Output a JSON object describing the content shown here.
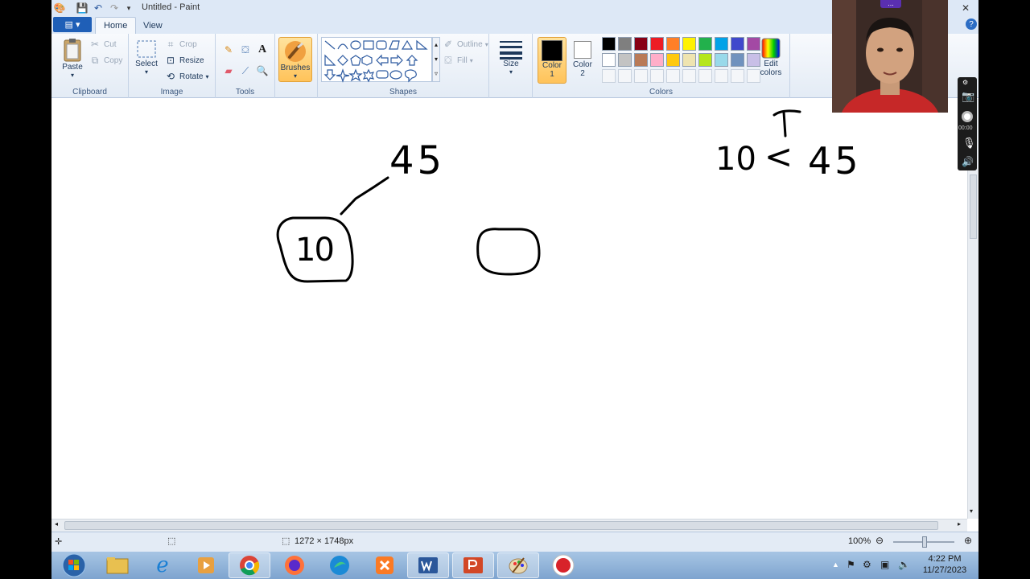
{
  "window": {
    "title": "Untitled - Paint"
  },
  "tabs": {
    "file": "",
    "home": "Home",
    "view": "View"
  },
  "clipboard": {
    "paste": "Paste",
    "cut": "Cut",
    "copy": "Copy",
    "label": "Clipboard"
  },
  "image": {
    "select": "Select",
    "crop": "Crop",
    "resize": "Resize",
    "rotate": "Rotate",
    "label": "Image"
  },
  "tools": {
    "label": "Tools",
    "text_glyph": "A"
  },
  "brushes": {
    "label": "Brushes"
  },
  "shapes": {
    "outline": "Outline",
    "fill": "Fill",
    "label": "Shapes"
  },
  "size": {
    "label": "Size"
  },
  "colors": {
    "color1_line1": "Color",
    "color1_line2": "1",
    "color2_line1": "Color",
    "color2_line2": "2",
    "edit_line1": "Edit",
    "edit_line2": "colors",
    "label": "Colors",
    "palette_row1": [
      "#000000",
      "#7f7f7f",
      "#880015",
      "#ed1c24",
      "#ff7f27",
      "#fff200",
      "#22b14c",
      "#00a2e8",
      "#3f48cc",
      "#a349a4"
    ],
    "palette_row2": [
      "#ffffff",
      "#c3c3c3",
      "#b97a57",
      "#ffaec9",
      "#ffc90e",
      "#efe4b0",
      "#b5e61d",
      "#99d9ea",
      "#7092be",
      "#c8bfe7"
    ],
    "color1": "#000000",
    "color2": "#ffffff"
  },
  "drawing": {
    "label_top": "45",
    "label_node": "10",
    "expr_left": "10",
    "expr_op": "<",
    "expr_right": "45",
    "mark": "T"
  },
  "status": {
    "dimensions": "1272 × 1748px",
    "zoom": "100%"
  },
  "clock": {
    "time": "4:22 PM",
    "date": "11/27/2023"
  },
  "taskbar": {
    "apps": [
      "start-orb-icon",
      "file-explorer-icon",
      "internet-explorer-icon",
      "media-player-icon",
      "chrome-icon",
      "firefox-icon",
      "edge-icon",
      "xampp-icon",
      "word-icon",
      "powerpoint-icon",
      "paint-icon",
      "recorder-icon"
    ]
  },
  "camera": {
    "timer": "00:00",
    "menu": "..."
  }
}
